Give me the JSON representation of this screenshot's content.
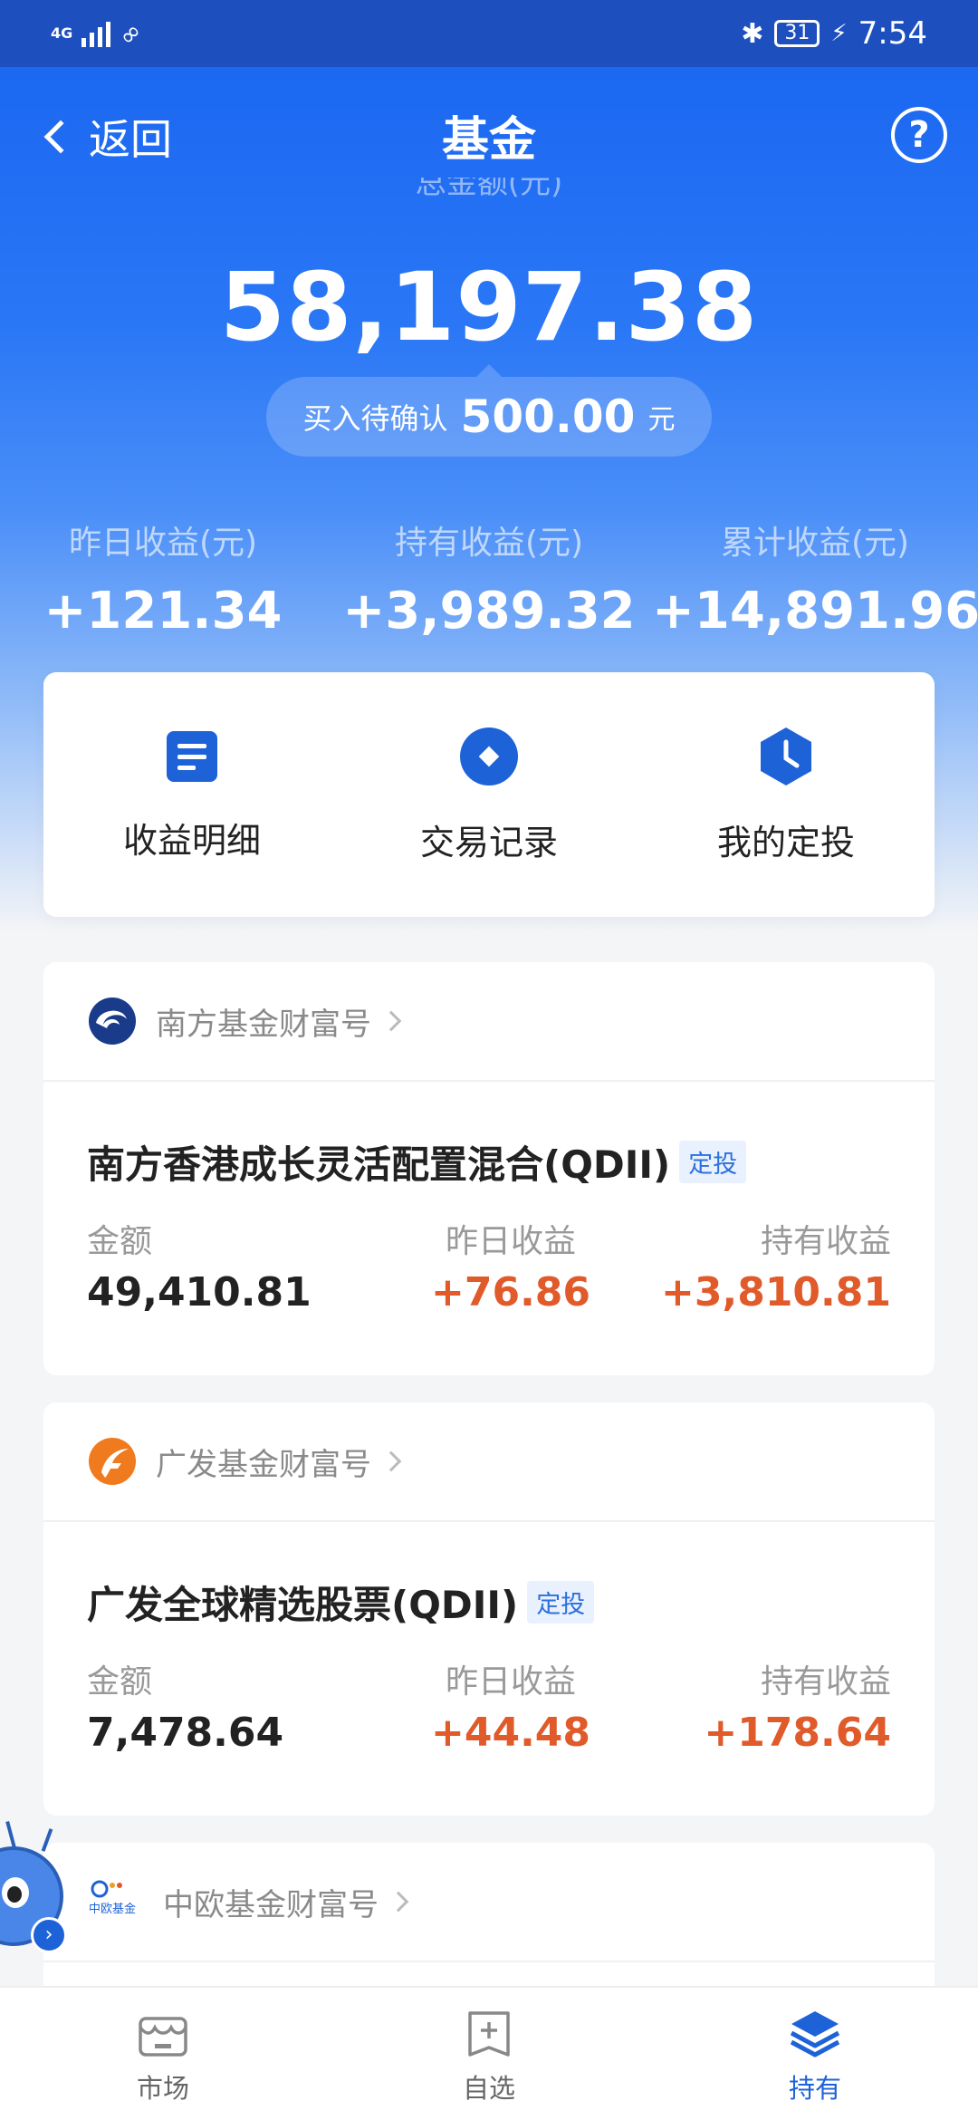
{
  "status_bar": {
    "network": "4G",
    "battery": "31",
    "time": "7:54"
  },
  "nav": {
    "back_label": "返回",
    "title": "基金",
    "help_symbol": "?"
  },
  "summary": {
    "total_label": "总金额(元)",
    "total_amount": "58,197.38",
    "pending_label": "买入待确认",
    "pending_amount": "500.00",
    "pending_unit": "元",
    "stats": [
      {
        "label": "昨日收益(元)",
        "value": "+121.34"
      },
      {
        "label": "持有收益(元)",
        "value": "+3,989.32"
      },
      {
        "label": "累计收益(元)",
        "value": "+14,891.96"
      }
    ]
  },
  "actions": [
    {
      "label": "收益明细",
      "icon": "document-icon"
    },
    {
      "label": "交易记录",
      "icon": "record-icon"
    },
    {
      "label": "我的定投",
      "icon": "clock-icon"
    }
  ],
  "funds": [
    {
      "org": "南方基金财富号",
      "name": "南方香港成长灵活配置混合(QDII)",
      "tag": "定投",
      "amount_label": "金额",
      "amount": "49,410.81",
      "yday_label": "昨日收益",
      "yday": "+76.86",
      "hold_label": "持有收益",
      "hold": "+3,810.81"
    },
    {
      "org": "广发基金财富号",
      "name": "广发全球精选股票(QDII)",
      "tag": "定投",
      "amount_label": "金额",
      "amount": "7,478.64",
      "yday_label": "昨日收益",
      "yday": "+44.48",
      "hold_label": "持有收益",
      "hold": "+178.64"
    },
    {
      "org": "中欧基金财富号",
      "logo_text": "中欧基金"
    }
  ],
  "tabbar": [
    {
      "label": "市场",
      "icon": "market-icon"
    },
    {
      "label": "自选",
      "icon": "add-watchlist-icon"
    },
    {
      "label": "持有",
      "icon": "layers-icon",
      "active": true
    }
  ],
  "colors": {
    "primary": "#1e62d8",
    "positive": "#e05a2a",
    "status_bar": "#1d4fbf"
  }
}
